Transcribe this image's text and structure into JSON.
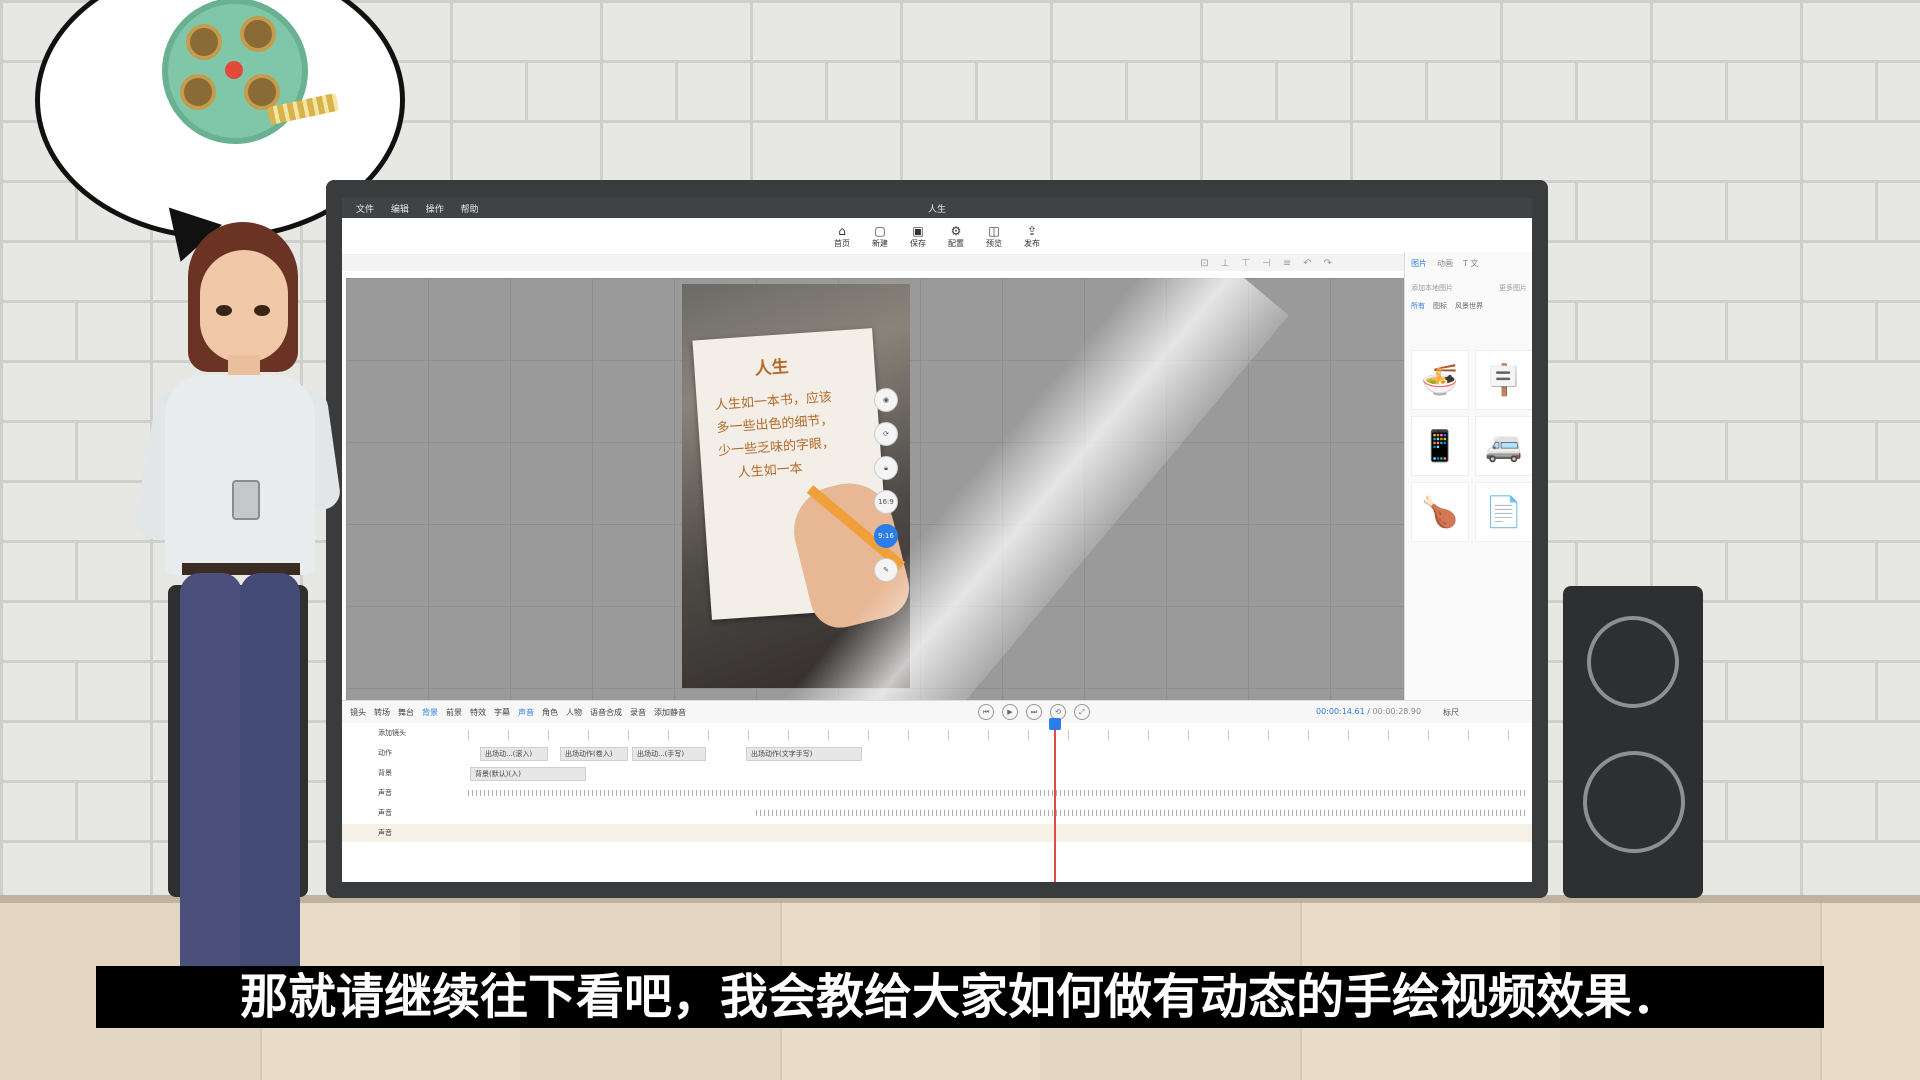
{
  "app": {
    "menu": [
      "文件",
      "编辑",
      "操作",
      "帮助"
    ],
    "document_title": "人生",
    "toolbar": [
      {
        "label": "首页",
        "icon": "home-icon"
      },
      {
        "label": "新建",
        "icon": "new-file-icon"
      },
      {
        "label": "保存",
        "icon": "save-icon"
      },
      {
        "label": "配置",
        "icon": "settings-icon"
      },
      {
        "label": "预览",
        "icon": "preview-icon"
      },
      {
        "label": "发布",
        "icon": "publish-icon"
      }
    ],
    "preview_card": {
      "title": "人生",
      "lines": [
        "人生如一本书，应该",
        "多一些出色的细节，",
        "少一些乏味的字眼，",
        "人生如一本"
      ]
    },
    "side_tools": [
      "",
      "",
      "",
      "16:9",
      "9:16",
      ""
    ],
    "right_panel": {
      "tabs": [
        "图片",
        "动画",
        "T 文"
      ],
      "add_button": "添加本地图片",
      "more_link": "更多图片",
      "categories": [
        "所有",
        "图标",
        "风景世界"
      ],
      "items": [
        "🍜",
        "🪧",
        "📱",
        "🚐",
        "🍗",
        "📄",
        "✔️",
        "🧳",
        "❌",
        "✈️"
      ]
    },
    "timeline_tabs": [
      "镜头",
      "转场",
      "舞台",
      "背景",
      "前景",
      "特效",
      "字幕",
      "声音",
      "角色",
      "人物",
      "语音合成",
      "录音",
      "添加静音"
    ],
    "timecode": {
      "current": "00:00:14.61",
      "separator": "/",
      "total": "00:00:28.90"
    },
    "ruler_label": "标尺",
    "tracks": [
      {
        "name": "添加镜头",
        "clips": []
      },
      {
        "name": "动作",
        "clips": [
          "出场动...(滚入)",
          "出场动作(卷入)",
          "出场动...(手写)",
          "出场动作(文字手写)"
        ]
      },
      {
        "name": "背景",
        "clips": [
          "背景(默认)(入)"
        ]
      },
      {
        "name": "声音",
        "clips": []
      },
      {
        "name": "声音",
        "clips": []
      },
      {
        "name": "声音",
        "clips": []
      }
    ]
  },
  "subtitle": "那就请继续往下看吧，我会教给大家如何做有动态的手绘视频效果．"
}
